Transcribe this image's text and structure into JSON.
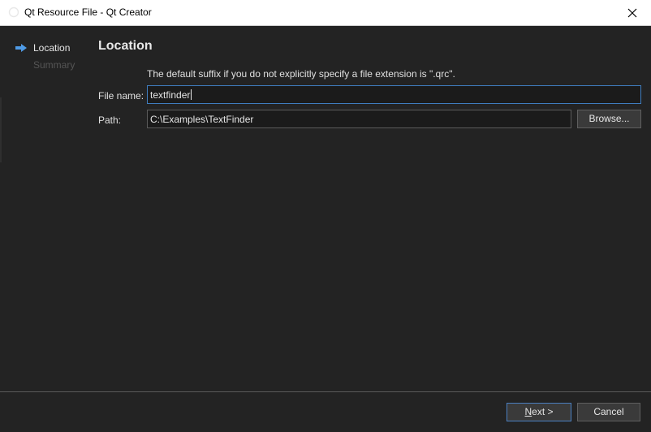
{
  "window": {
    "title": "Qt Resource File - Qt Creator"
  },
  "sidebar": {
    "steps": [
      {
        "label": "Location",
        "active": true
      },
      {
        "label": "Summary",
        "active": false
      }
    ]
  },
  "page": {
    "title": "Location",
    "hint": "The default suffix if you do not explicitly specify a file extension is \".qrc\".",
    "file_name_label": "File name:",
    "file_name_value": "textfinder",
    "path_label": "Path:",
    "path_value": "C:\\Examples\\TextFinder",
    "browse_label": "Browse..."
  },
  "footer": {
    "next_mnemonic": "N",
    "next_rest": "ext >",
    "cancel_label": "Cancel"
  },
  "colors": {
    "background": "#232323",
    "accent": "#3f7dbf",
    "step_arrow": "#4f9be6"
  },
  "icons": {
    "app": "qt-creator-icon",
    "close": "close-icon",
    "step": "arrow-right-icon"
  }
}
